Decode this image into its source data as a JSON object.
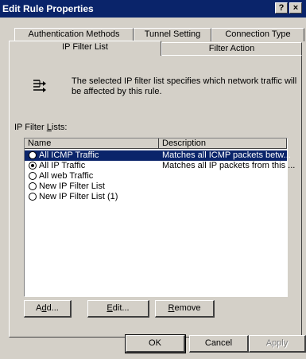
{
  "window": {
    "title": "Edit Rule Properties",
    "help_label": "?",
    "close_label": "×"
  },
  "tabs": {
    "row1": [
      "Authentication Methods",
      "Tunnel Setting",
      "Connection Type"
    ],
    "row2": [
      "IP Filter List",
      "Filter Action"
    ],
    "active": "IP Filter List"
  },
  "panel": {
    "info_text": "The selected IP filter list specifies which network traffic will be affected by this rule.",
    "lists_label_pre": "IP Filter ",
    "lists_label_hotkey": "L",
    "lists_label_post": "ists:"
  },
  "table": {
    "columns": [
      "Name",
      "Description"
    ],
    "rows": [
      {
        "name": "All ICMP Traffic",
        "description": "Matches all ICMP packets betw...",
        "checked": false,
        "selected": true
      },
      {
        "name": "All IP Traffic",
        "description": "Matches all IP packets from this ...",
        "checked": true,
        "selected": false
      },
      {
        "name": "All web Traffic",
        "description": "",
        "checked": false,
        "selected": false
      },
      {
        "name": "New IP Filter List",
        "description": "",
        "checked": false,
        "selected": false
      },
      {
        "name": "New IP Filter List (1)",
        "description": "",
        "checked": false,
        "selected": false
      }
    ]
  },
  "buttons": {
    "add": {
      "pre": "A",
      "hotkey": "d",
      "post": "d..."
    },
    "edit": {
      "pre": "",
      "hotkey": "E",
      "post": "dit..."
    },
    "remove": {
      "pre": "",
      "hotkey": "R",
      "post": "emove"
    },
    "ok": "OK",
    "cancel": "Cancel",
    "apply": "Apply"
  }
}
